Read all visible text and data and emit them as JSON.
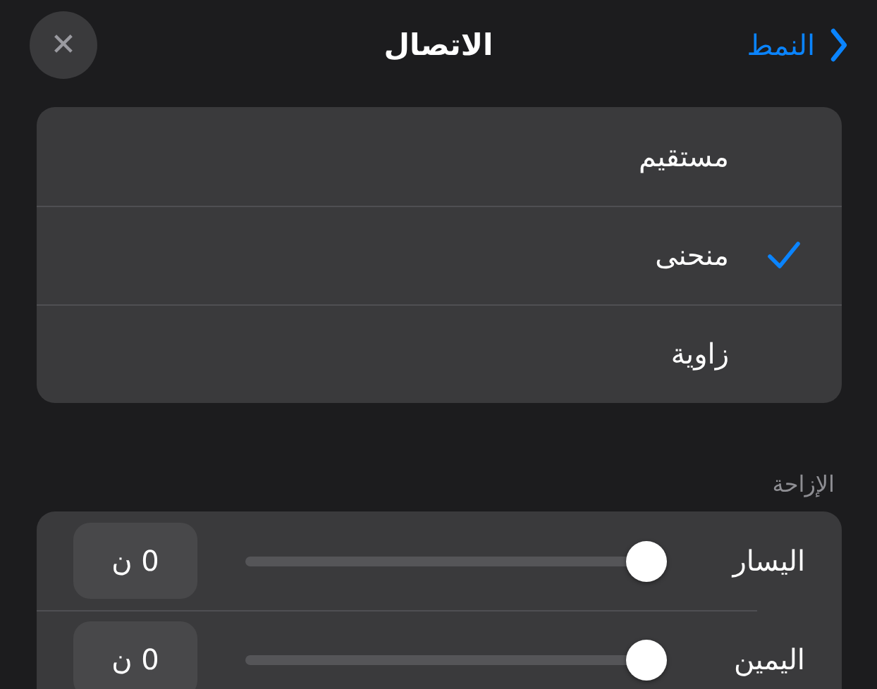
{
  "header": {
    "back_label": "النمط",
    "title": "الاتصال",
    "close_icon": "✕"
  },
  "connection_types": [
    {
      "label": "مستقيم",
      "selected": false
    },
    {
      "label": "منحنى",
      "selected": true
    },
    {
      "label": "زاوية",
      "selected": false
    }
  ],
  "offset": {
    "heading": "الإزاحة",
    "rows": [
      {
        "label": "اليسار",
        "value": "0 ن"
      },
      {
        "label": "اليمين",
        "value": "0 ن"
      }
    ]
  }
}
